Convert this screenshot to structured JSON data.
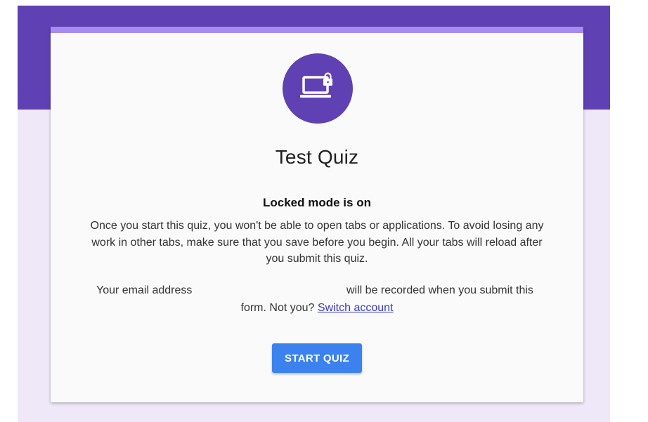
{
  "colors": {
    "header_band": "#6041b4",
    "card_accent": "#a88bf0",
    "stage_background": "#efe8f8",
    "card_background": "#fafafa",
    "button": "#3b82ee",
    "link": "#3a3acb"
  },
  "quiz": {
    "icon": "laptop-lock-icon",
    "title": "Test Quiz",
    "mode_heading": "Locked mode is on",
    "description": "Once you start this quiz, you won't be able to open tabs or applications. To avoid losing any work in other tabs, make sure that you save before you begin. All your tabs will reload after you submit this quiz."
  },
  "email_notice": {
    "label": "Your email address",
    "email": "",
    "suffix": "will be recorded when you submit this",
    "line2_prefix": "form. Not you?",
    "switch_link": "Switch account"
  },
  "actions": {
    "start_label": "START QUIZ"
  }
}
